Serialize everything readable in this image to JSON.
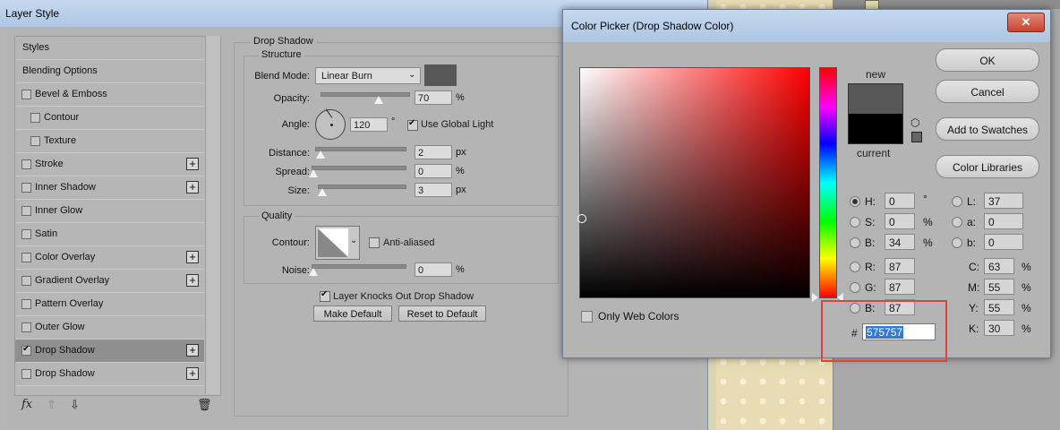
{
  "layer_style": {
    "title": "Layer Style",
    "styles": [
      {
        "label": "Styles",
        "checkbox": false,
        "checked": false,
        "indent": false,
        "plus": false,
        "selected": false
      },
      {
        "label": "Blending Options",
        "checkbox": false,
        "checked": false,
        "indent": false,
        "plus": false,
        "selected": false
      },
      {
        "label": "Bevel & Emboss",
        "checkbox": true,
        "checked": false,
        "indent": false,
        "plus": false,
        "selected": false
      },
      {
        "label": "Contour",
        "checkbox": true,
        "checked": false,
        "indent": true,
        "plus": false,
        "selected": false
      },
      {
        "label": "Texture",
        "checkbox": true,
        "checked": false,
        "indent": true,
        "plus": false,
        "selected": false
      },
      {
        "label": "Stroke",
        "checkbox": true,
        "checked": false,
        "indent": false,
        "plus": true,
        "selected": false
      },
      {
        "label": "Inner Shadow",
        "checkbox": true,
        "checked": false,
        "indent": false,
        "plus": true,
        "selected": false
      },
      {
        "label": "Inner Glow",
        "checkbox": true,
        "checked": false,
        "indent": false,
        "plus": false,
        "selected": false
      },
      {
        "label": "Satin",
        "checkbox": true,
        "checked": false,
        "indent": false,
        "plus": false,
        "selected": false
      },
      {
        "label": "Color Overlay",
        "checkbox": true,
        "checked": false,
        "indent": false,
        "plus": true,
        "selected": false
      },
      {
        "label": "Gradient Overlay",
        "checkbox": true,
        "checked": false,
        "indent": false,
        "plus": true,
        "selected": false
      },
      {
        "label": "Pattern Overlay",
        "checkbox": true,
        "checked": false,
        "indent": false,
        "plus": false,
        "selected": false
      },
      {
        "label": "Outer Glow",
        "checkbox": true,
        "checked": false,
        "indent": false,
        "plus": false,
        "selected": false
      },
      {
        "label": "Drop Shadow",
        "checkbox": true,
        "checked": true,
        "indent": false,
        "plus": true,
        "selected": true
      },
      {
        "label": "Drop Shadow",
        "checkbox": true,
        "checked": false,
        "indent": false,
        "plus": true,
        "selected": false
      }
    ],
    "toolbar": {
      "fx": "fx",
      "up": "⇧",
      "down": "⇩",
      "trash": "🗑"
    },
    "drop_shadow": {
      "title": "Drop Shadow",
      "structure": {
        "title": "Structure",
        "blend_mode_label": "Blend Mode:",
        "blend_mode_value": "Linear Burn",
        "shadow_color": "#575757",
        "opacity_label": "Opacity:",
        "opacity_value": "70",
        "opacity_unit": "%",
        "angle_label": "Angle:",
        "angle_value": "120",
        "angle_unit": "°",
        "use_global_light_label": "Use Global Light",
        "use_global_light": true,
        "distance_label": "Distance:",
        "distance_value": "2",
        "distance_unit": "px",
        "spread_label": "Spread:",
        "spread_value": "0",
        "spread_unit": "%",
        "size_label": "Size:",
        "size_value": "3",
        "size_unit": "px"
      },
      "quality": {
        "title": "Quality",
        "contour_label": "Contour:",
        "anti_aliased_label": "Anti-aliased",
        "anti_aliased": false,
        "noise_label": "Noise:",
        "noise_value": "0",
        "noise_unit": "%"
      },
      "knocks_out_label": "Layer Knocks Out Drop Shadow",
      "knocks_out": true,
      "make_default_label": "Make Default",
      "reset_default_label": "Reset to Default"
    }
  },
  "color_picker": {
    "title": "Color Picker (Drop Shadow Color)",
    "close_icon": "✕",
    "new_label": "new",
    "current_label": "current",
    "new_color": "#575757",
    "current_color": "#000000",
    "buttons": {
      "ok": "OK",
      "cancel": "Cancel",
      "add_to_swatches": "Add to Swatches",
      "color_libraries": "Color Libraries"
    },
    "hsb": [
      {
        "label": "H:",
        "value": "0",
        "unit": "°",
        "selected": true
      },
      {
        "label": "S:",
        "value": "0",
        "unit": "%",
        "selected": false
      },
      {
        "label": "B:",
        "value": "34",
        "unit": "%",
        "selected": false
      }
    ],
    "rgb": [
      {
        "label": "R:",
        "value": "87"
      },
      {
        "label": "G:",
        "value": "87"
      },
      {
        "label": "B:",
        "value": "87"
      }
    ],
    "lab": [
      {
        "label": "L:",
        "value": "37"
      },
      {
        "label": "a:",
        "value": "0"
      },
      {
        "label": "b:",
        "value": "0"
      }
    ],
    "cmyk": [
      {
        "label": "C:",
        "value": "63",
        "unit": "%"
      },
      {
        "label": "M:",
        "value": "55",
        "unit": "%"
      },
      {
        "label": "Y:",
        "value": "55",
        "unit": "%"
      },
      {
        "label": "K:",
        "value": "30",
        "unit": "%"
      }
    ],
    "hex_label": "#",
    "hex_value": "575757",
    "only_web_colors_label": "Only Web Colors",
    "only_web_colors": false,
    "highlight_color": "#e0433c"
  }
}
